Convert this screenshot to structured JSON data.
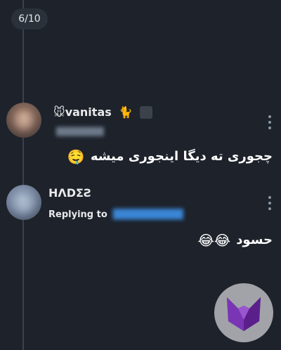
{
  "page_counter": "6/10",
  "comments": [
    {
      "name_prefix_emoji": "🐭",
      "name": "vanitas",
      "name_suffix_emoji": "🐈",
      "message": "چجوری ته دیگا اینجوری میشه",
      "message_emoji": "🤤"
    },
    {
      "name": "HΛDΣƧ",
      "replying_to_label": "Replying to",
      "message": "حسود",
      "message_emoji": "😂😂"
    }
  ],
  "colors": {
    "background": "#1d222b",
    "text": "#e7e9ea",
    "link": "#3a86d6",
    "fab_background": "#a1a3a8",
    "fab_logo": "#6a2aa0"
  },
  "icons": {
    "more": "vertical-dots-icon",
    "fab_logo": "fox-logo-icon"
  }
}
